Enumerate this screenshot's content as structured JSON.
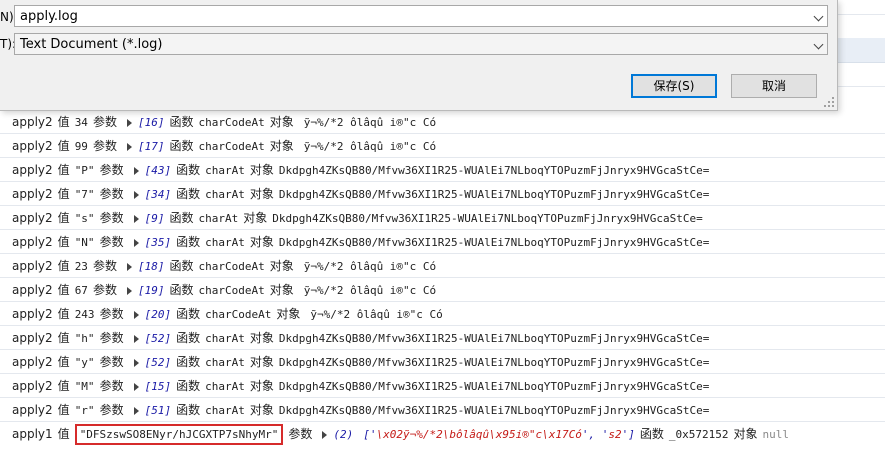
{
  "dialog": {
    "filename_label": "N):",
    "filename_value": "apply.log",
    "filetype_label": "T):",
    "filetype_value": "Text Document (*.log)",
    "save_button": "保存(S)",
    "cancel_button": "取消"
  },
  "console": {
    "char_code_out": "ỹ¬%/*2  ôlâqû  i®\"c  Có",
    "char_at_out": "Dkdpgh4ZKsQB80/Mfvw36XI1R25-WUAlEi7NLboqYTOPuzmFjJnryx9HVGcaStCe=",
    "rows": [
      {
        "fn": "apply2",
        "v1": "值",
        "val": "34",
        "v2": "参数",
        "idx": "[16]",
        "f": "函数",
        "method": "charCodeAt",
        "obj": "对象",
        "out": "ỹ¬%/*2  ôlâqû  i®\"c  Có"
      },
      {
        "fn": "apply2",
        "v1": "值",
        "val": "99",
        "v2": "参数",
        "idx": "[17]",
        "f": "函数",
        "method": "charCodeAt",
        "obj": "对象",
        "out": "ỹ¬%/*2  ôlâqû  i®\"c  Có"
      },
      {
        "fn": "apply2",
        "v1": "值",
        "val": "\"P\"",
        "v2": "参数",
        "idx": "[43]",
        "f": "函数",
        "method": "charAt",
        "obj": "对象",
        "out": "Dkdpgh4ZKsQB80/Mfvw36XI1R25-WUAlEi7NLboqYTOPuzmFjJnryx9HVGcaStCe="
      },
      {
        "fn": "apply2",
        "v1": "值",
        "val": "\"7\"",
        "v2": "参数",
        "idx": "[34]",
        "f": "函数",
        "method": "charAt",
        "obj": "对象",
        "out": "Dkdpgh4ZKsQB80/Mfvw36XI1R25-WUAlEi7NLboqYTOPuzmFjJnryx9HVGcaStCe="
      },
      {
        "fn": "apply2",
        "v1": "值",
        "val": "\"s\"",
        "v2": "参数",
        "idx": "[9]",
        "f": "函数",
        "method": "charAt",
        "obj": "对象",
        "out": "Dkdpgh4ZKsQB80/Mfvw36XI1R25-WUAlEi7NLboqYTOPuzmFjJnryx9HVGcaStCe="
      },
      {
        "fn": "apply2",
        "v1": "值",
        "val": "\"N\"",
        "v2": "参数",
        "idx": "[35]",
        "f": "函数",
        "method": "charAt",
        "obj": "对象",
        "out": "Dkdpgh4ZKsQB80/Mfvw36XI1R25-WUAlEi7NLboqYTOPuzmFjJnryx9HVGcaStCe="
      },
      {
        "fn": "apply2",
        "v1": "值",
        "val": "23",
        "v2": "参数",
        "idx": "[18]",
        "f": "函数",
        "method": "charCodeAt",
        "obj": "对象",
        "out": "ỹ¬%/*2  ôlâqû  i®\"c  Có"
      },
      {
        "fn": "apply2",
        "v1": "值",
        "val": "67",
        "v2": "参数",
        "idx": "[19]",
        "f": "函数",
        "method": "charCodeAt",
        "obj": "对象",
        "out": "ỹ¬%/*2  ôlâqû  i®\"c  Có"
      },
      {
        "fn": "apply2",
        "v1": "值",
        "val": "243",
        "v2": "参数",
        "idx": "[20]",
        "f": "函数",
        "method": "charCodeAt",
        "obj": "对象",
        "out": "ỹ¬%/*2  ôlâqû  i®\"c  Có"
      },
      {
        "fn": "apply2",
        "v1": "值",
        "val": "\"h\"",
        "v2": "参数",
        "idx": "[52]",
        "f": "函数",
        "method": "charAt",
        "obj": "对象",
        "out": "Dkdpgh4ZKsQB80/Mfvw36XI1R25-WUAlEi7NLboqYTOPuzmFjJnryx9HVGcaStCe="
      },
      {
        "fn": "apply2",
        "v1": "值",
        "val": "\"y\"",
        "v2": "参数",
        "idx": "[52]",
        "f": "函数",
        "method": "charAt",
        "obj": "对象",
        "out": "Dkdpgh4ZKsQB80/Mfvw36XI1R25-WUAlEi7NLboqYTOPuzmFjJnryx9HVGcaStCe="
      },
      {
        "fn": "apply2",
        "v1": "值",
        "val": "\"M\"",
        "v2": "参数",
        "idx": "[15]",
        "f": "函数",
        "method": "charAt",
        "obj": "对象",
        "out": "Dkdpgh4ZKsQB80/Mfvw36XI1R25-WUAlEi7NLboqYTOPuzmFjJnryx9HVGcaStCe="
      },
      {
        "fn": "apply2",
        "v1": "值",
        "val": "\"r\"",
        "v2": "参数",
        "idx": "[51]",
        "f": "函数",
        "method": "charAt",
        "obj": "对象",
        "out": "Dkdpgh4ZKsQB80/Mfvw36XI1R25-WUAlEi7NLboqYTOPuzmFjJnryx9HVGcaStCe="
      }
    ],
    "last_row": {
      "fn": "apply1",
      "v1": "值",
      "val": "\"DFSzswSO8ENyr/hJCGXTP7sNhyMr\"",
      "v2": "参数",
      "count": "(2)",
      "arr_open": "['",
      "arr_item1": "\\x02ỹ¬%/*2\\bôlâqû\\x95i®\"c\\x17Có",
      "arr_sep": "', '",
      "arr_item2": "s2",
      "arr_close": "']",
      "f": "函数",
      "fname": "_0x572152",
      "obj": "对象",
      "nullval": "null"
    }
  }
}
